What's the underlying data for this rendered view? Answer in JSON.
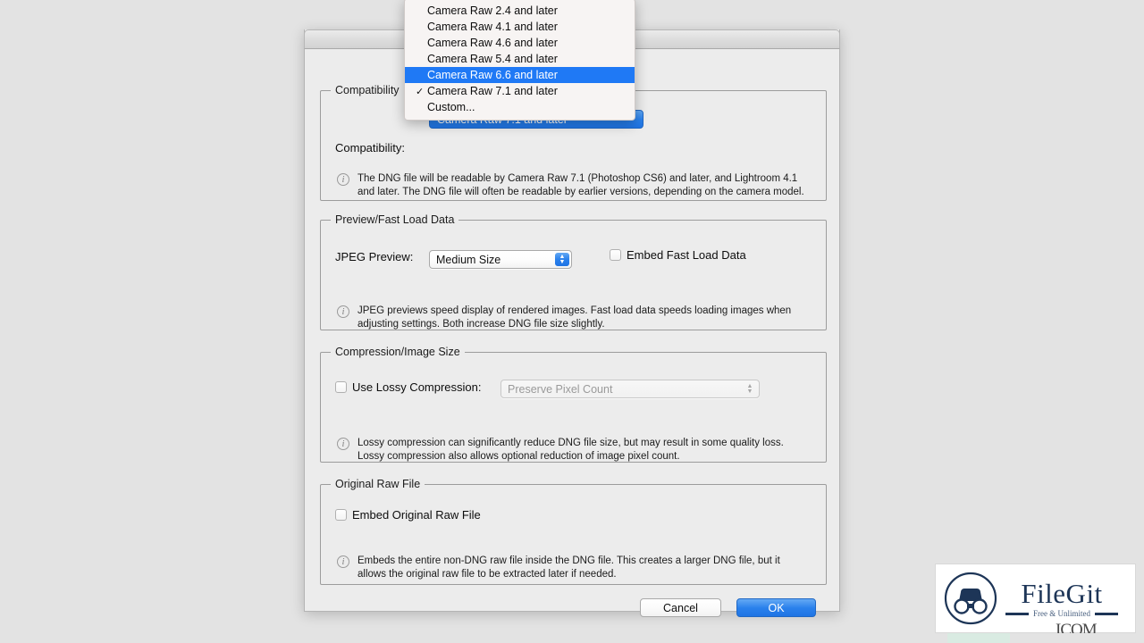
{
  "window": {
    "title": ""
  },
  "sections": {
    "compatibility": {
      "group_title": "Compatibility",
      "field_label": "Compatibility:",
      "selected_value": "Camera Raw 7.1 and later",
      "note": "The DNG file will be readable by Camera Raw 7.1 (Photoshop CS6) and later, and Lightroom 4.1 and later. The DNG file will often be readable by earlier versions, depending on the camera model.",
      "info_icon": "info-icon"
    },
    "preview": {
      "group_title": "Preview/Fast Load Data",
      "field_label": "JPEG Preview:",
      "selected_value": "Medium Size",
      "checkbox_label": "Embed Fast Load Data",
      "checkbox_checked": false,
      "note": "JPEG previews speed display of rendered images.  Fast load data speeds loading images when adjusting settings.  Both increase DNG file size slightly.",
      "info_icon": "info-icon"
    },
    "compression": {
      "group_title": "Compression/Image Size",
      "checkbox_label": "Use Lossy Compression:",
      "checkbox_checked": false,
      "selected_value": "Preserve Pixel Count",
      "disabled": true,
      "note": "Lossy compression can significantly reduce DNG file size, but may result in some quality loss. Lossy compression also allows optional reduction of image pixel count.",
      "info_icon": "info-icon"
    },
    "original_raw": {
      "group_title": "Original Raw File",
      "checkbox_label": "Embed Original Raw File",
      "checkbox_checked": false,
      "note": "Embeds the entire non-DNG raw file inside the DNG file.  This creates a larger DNG file, but it allows the original raw file to be extracted later if needed.",
      "info_icon": "info-icon"
    }
  },
  "footer": {
    "cancel_label": "Cancel",
    "ok_label": "OK"
  },
  "dropdown_menu": {
    "open": true,
    "checkmark_glyph": "✓",
    "items": [
      {
        "label": "Camera Raw 2.4 and later",
        "checked": false,
        "highlighted": false
      },
      {
        "label": "Camera Raw 4.1 and later",
        "checked": false,
        "highlighted": false
      },
      {
        "label": "Camera Raw 4.6 and later",
        "checked": false,
        "highlighted": false
      },
      {
        "label": "Camera Raw 5.4 and later",
        "checked": false,
        "highlighted": false
      },
      {
        "label": "Camera Raw 6.6 and later",
        "checked": false,
        "highlighted": true
      },
      {
        "label": "Camera Raw 7.1 and later",
        "checked": true,
        "highlighted": false
      },
      {
        "label": "Custom...",
        "checked": false,
        "highlighted": false
      }
    ]
  },
  "watermark": {
    "name": "FileGit",
    "tagline": "Free & Unlimited",
    "logo_icon": "binoculars-icon",
    "ghost_text": "ICOM"
  },
  "colors": {
    "accent_blue": "#1f79f5",
    "popup_blue": "#2a81ec",
    "page_background": "#e3e3e3",
    "dialog_background": "#ececec",
    "menu_background": "#f7f4f3",
    "brand_navy": "#1d3557"
  }
}
